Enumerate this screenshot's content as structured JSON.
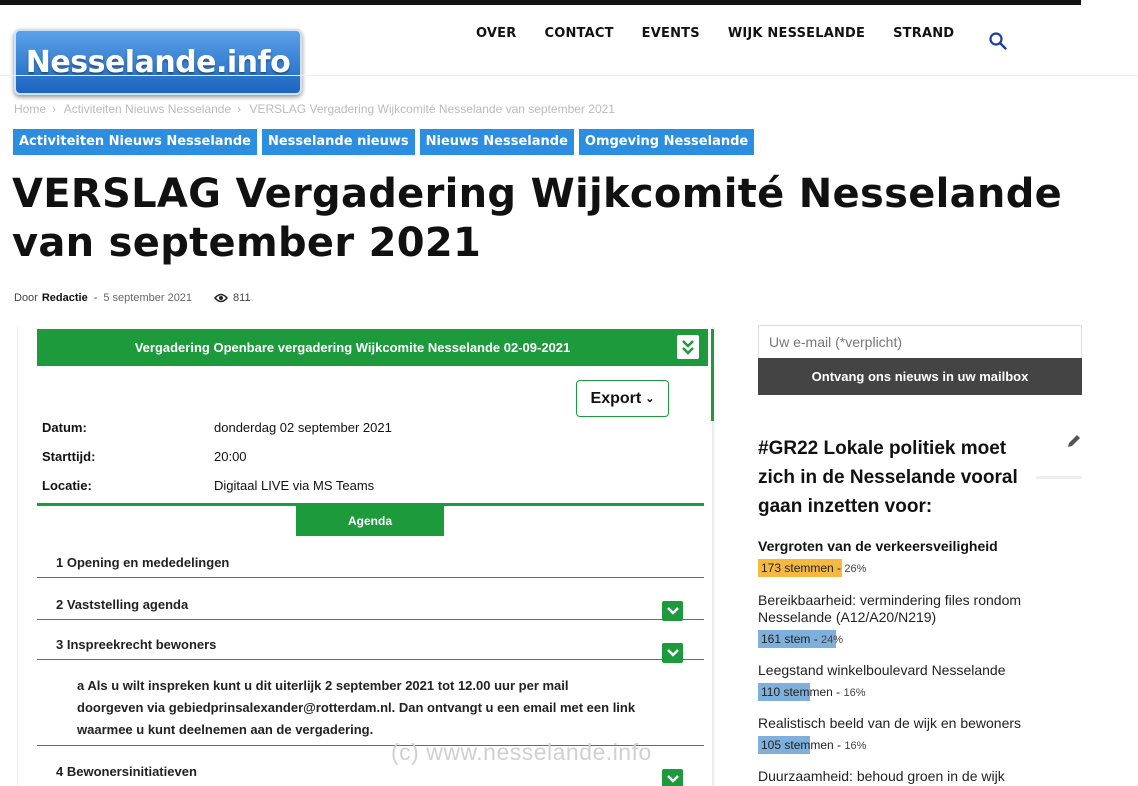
{
  "site": {
    "logo_text": "Nesselande.info"
  },
  "nav": [
    "OVER",
    "CONTACT",
    "EVENTS",
    "WIJK NESSELANDE",
    "STRAND"
  ],
  "breadcrumb": [
    "Home",
    "Activiteiten Nieuws Nesselande",
    "VERSLAG Vergadering Wijkcomité Nesselande van september 2021"
  ],
  "categories": [
    "Activiteiten Nieuws Nesselande",
    "Nesselande nieuws",
    "Nieuws Nesselande",
    "Omgeving Nesselande"
  ],
  "article": {
    "title": "VERSLAG Vergadering Wijkcomité Nesselande van september 2021",
    "by_label": "Door",
    "author": "Redactie",
    "date": "5 september 2021",
    "views": "811"
  },
  "meeting": {
    "header": "Vergadering Openbare vergadering Wijkcomite Nesselande 02-09-2021",
    "export_label": "Export",
    "fields": [
      {
        "label": "Datum:",
        "value": "donderdag 02 september 2021"
      },
      {
        "label": "Starttijd:",
        "value": "20:00"
      },
      {
        "label": "Locatie:",
        "value": "Digitaal LIVE via MS Teams"
      }
    ],
    "agenda_tab": "Agenda",
    "items": [
      "1 Opening en mededelingen",
      "2 Vaststelling agenda",
      "3 Inspreekrecht bewoners",
      "4 Bewonersinitiatieven"
    ],
    "paragraph": "a Als u wilt inspreken kunt u dit uiterlijk 2 september 2021 tot 12.00 uur per mail doorgeven via gebiedprinsalexander@rotterdam.nl. Dan ontvangt u een email met een link waarmee u kunt deelnemen aan de vergadering.",
    "watermark": "(c)  www.nesselande.info"
  },
  "sidebar": {
    "email_placeholder": "Uw e-mail (*verplicht)",
    "subscribe_label": "Ontvang ons nieuws in uw mailbox",
    "poll_title": "#GR22 Lokale politiek moet zich in de Nesselande vooral gaan inzetten voor:",
    "poll": [
      {
        "question": "Vergroten van de verkeersveiligheid",
        "votes": "173 stemmen",
        "percent": "26%",
        "share": 0.26,
        "color": "#f5b942",
        "bold": true
      },
      {
        "question": "Bereikbaarheid: vermindering files rondom Nesselande (A12/A20/N219)",
        "votes": "161 stem",
        "percent": "24%",
        "share": 0.24,
        "color": "#7fb0dc",
        "bold": false
      },
      {
        "question": "Leegstand winkelboulevard Nesselande",
        "votes": "110 stemmen",
        "percent": "16%",
        "share": 0.16,
        "color": "#7fb0dc",
        "bold": false
      },
      {
        "question": "Realistisch beeld van de wijk en bewoners",
        "votes": "105 stemmen",
        "percent": "16%",
        "share": 0.16,
        "color": "#7fb0dc",
        "bold": false
      },
      {
        "question": "Duurzaamheid: behoud groen in de wijk",
        "votes": "",
        "percent": "",
        "share": 0,
        "color": "#7fb0dc",
        "bold": false
      }
    ]
  }
}
